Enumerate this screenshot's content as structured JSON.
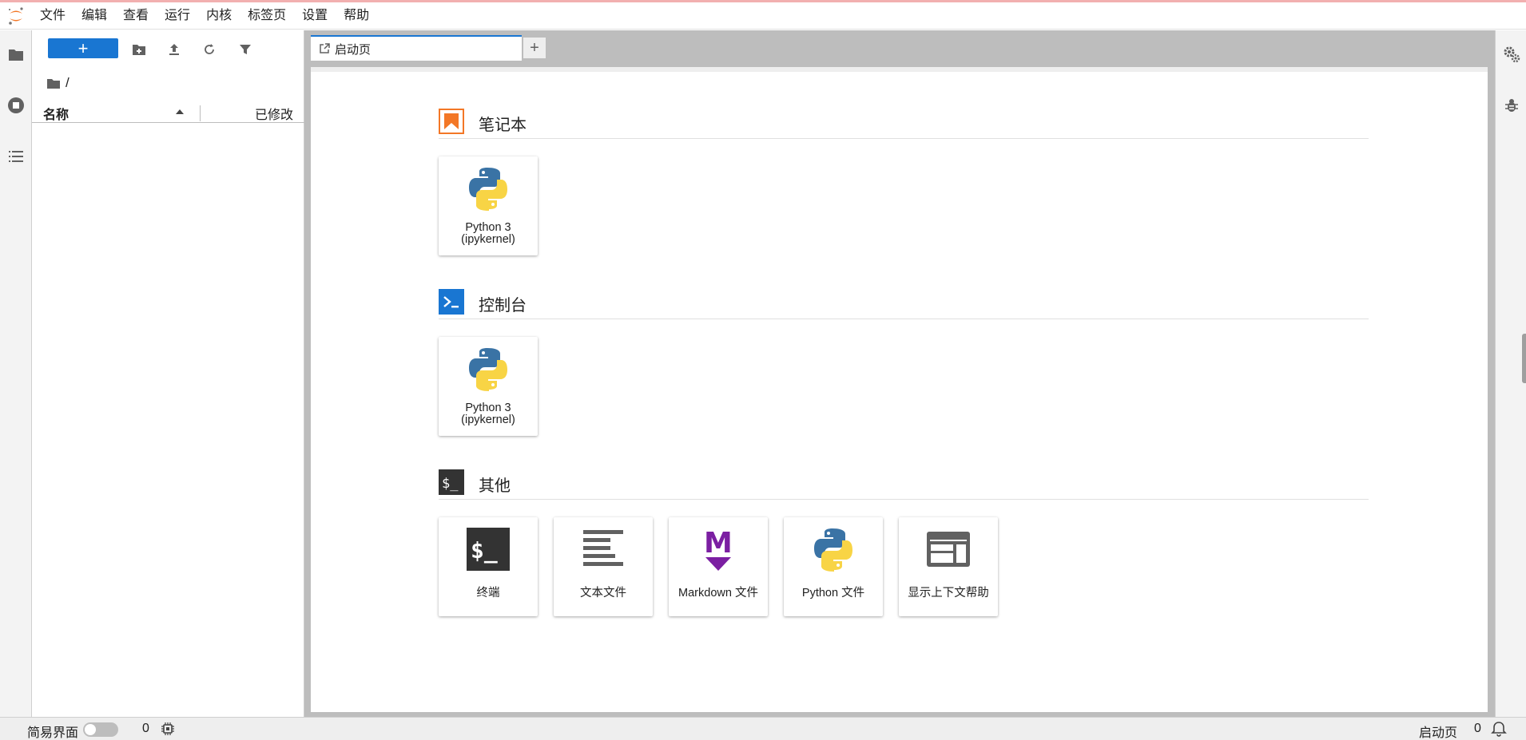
{
  "menu": {
    "items": [
      "文件",
      "编辑",
      "查看",
      "运行",
      "内核",
      "标签页",
      "设置",
      "帮助"
    ]
  },
  "file_browser": {
    "new_button_label": "+",
    "breadcrumb": "/",
    "column_name": "名称",
    "column_modified": "已修改"
  },
  "tabs": {
    "active_label": "启动页",
    "add_label": "+"
  },
  "launcher": {
    "sections": [
      {
        "title": "笔记本",
        "cards": [
          {
            "line1": "Python 3",
            "line2": "(ipykernel)"
          }
        ]
      },
      {
        "title": "控制台",
        "cards": [
          {
            "line1": "Python 3",
            "line2": "(ipykernel)"
          }
        ]
      },
      {
        "title": "其他",
        "cards": [
          {
            "label": "终端"
          },
          {
            "label": "文本文件"
          },
          {
            "label": "Markdown 文件"
          },
          {
            "label": "Python 文件"
          },
          {
            "label": "显示上下文帮助"
          }
        ]
      }
    ]
  },
  "statusbar": {
    "simple_mode": "简易界面",
    "kernel_count": "0",
    "right_label": "启动页",
    "notification_count": "0"
  },
  "colors": {
    "accent": "#1976d2",
    "notebook_orange": "#f37726",
    "markdown_purple": "#7b1fa2",
    "terminal_dark": "#333333"
  }
}
